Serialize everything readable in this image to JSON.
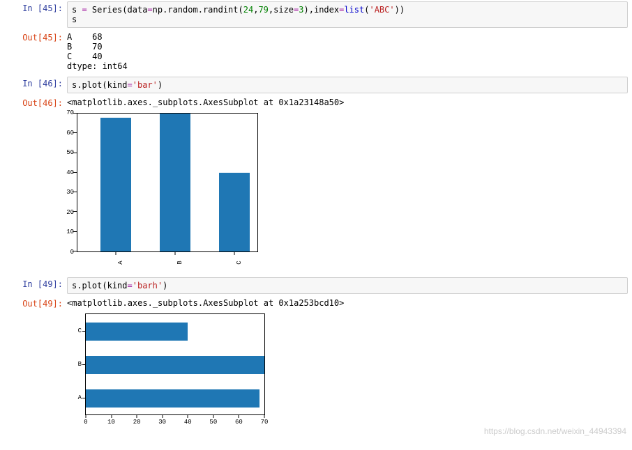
{
  "cells": {
    "c1": {
      "in_prompt": "In [45]:",
      "code_parts": {
        "s": "s",
        "eq": " = ",
        "Series": "Series",
        "p1": "(",
        "data_kw": "data",
        "eq2": "=",
        "np": "np",
        "dot": ".",
        "random": "random",
        "dot2": ".",
        "randint": "randint",
        "p2": "(",
        "n24": "24",
        "c1": ",",
        "n79": "79",
        "c2": ",",
        "size_kw": "size",
        "eq3": "=",
        "n3": "3",
        "p3": ")",
        "c3": ",",
        "index_kw": "index",
        "eq4": "=",
        "list": "list",
        "p4": "(",
        "abc": "'ABC'",
        "p5": ")",
        "p6": ")",
        "nl_s": "s"
      },
      "out_prompt": "Out[45]:",
      "output": "A    68\nB    70\nC    40\ndtype: int64"
    },
    "c2": {
      "in_prompt": "In [46]:",
      "code_parts": {
        "s": "s",
        "dot": ".",
        "plot": "plot",
        "p1": "(",
        "kind_kw": "kind",
        "eq": "=",
        "bar": "'bar'",
        "p2": ")"
      },
      "out_prompt": "Out[46]:",
      "repr": "<matplotlib.axes._subplots.AxesSubplot at 0x1a23148a50>"
    },
    "c3": {
      "in_prompt": "In [49]:",
      "code_parts": {
        "s": "s",
        "dot": ".",
        "plot": "plot",
        "p1": "(",
        "kind_kw": "kind",
        "eq": "=",
        "barh": "'barh'",
        "p2": ")"
      },
      "out_prompt": "Out[49]:",
      "repr": "<matplotlib.axes._subplots.AxesSubplot at 0x1a253bcd10>"
    }
  },
  "chart_data": [
    {
      "type": "bar",
      "title": "",
      "xlabel": "",
      "ylabel": "",
      "categories": [
        "A",
        "B",
        "C"
      ],
      "values": [
        68,
        70,
        40
      ],
      "ylim": [
        0,
        70
      ],
      "yticks": [
        0,
        10,
        20,
        30,
        40,
        50,
        60,
        70
      ]
    },
    {
      "type": "barh",
      "title": "",
      "xlabel": "",
      "ylabel": "",
      "categories": [
        "A",
        "B",
        "C"
      ],
      "values": [
        68,
        70,
        40
      ],
      "xlim": [
        0,
        70
      ],
      "xticks": [
        0,
        10,
        20,
        30,
        40,
        50,
        60,
        70
      ]
    }
  ],
  "chart1_ticks": {
    "y0": "0",
    "y10": "10",
    "y20": "20",
    "y30": "30",
    "y40": "40",
    "y50": "50",
    "y60": "60",
    "y70": "70",
    "xA": "A",
    "xB": "B",
    "xC": "C"
  },
  "chart2_ticks": {
    "x0": "0",
    "x10": "10",
    "x20": "20",
    "x30": "30",
    "x40": "40",
    "x50": "50",
    "x60": "60",
    "x70": "70",
    "yA": "A",
    "yB": "B",
    "yC": "C"
  },
  "watermark": "https://blog.csdn.net/weixin_44943394"
}
